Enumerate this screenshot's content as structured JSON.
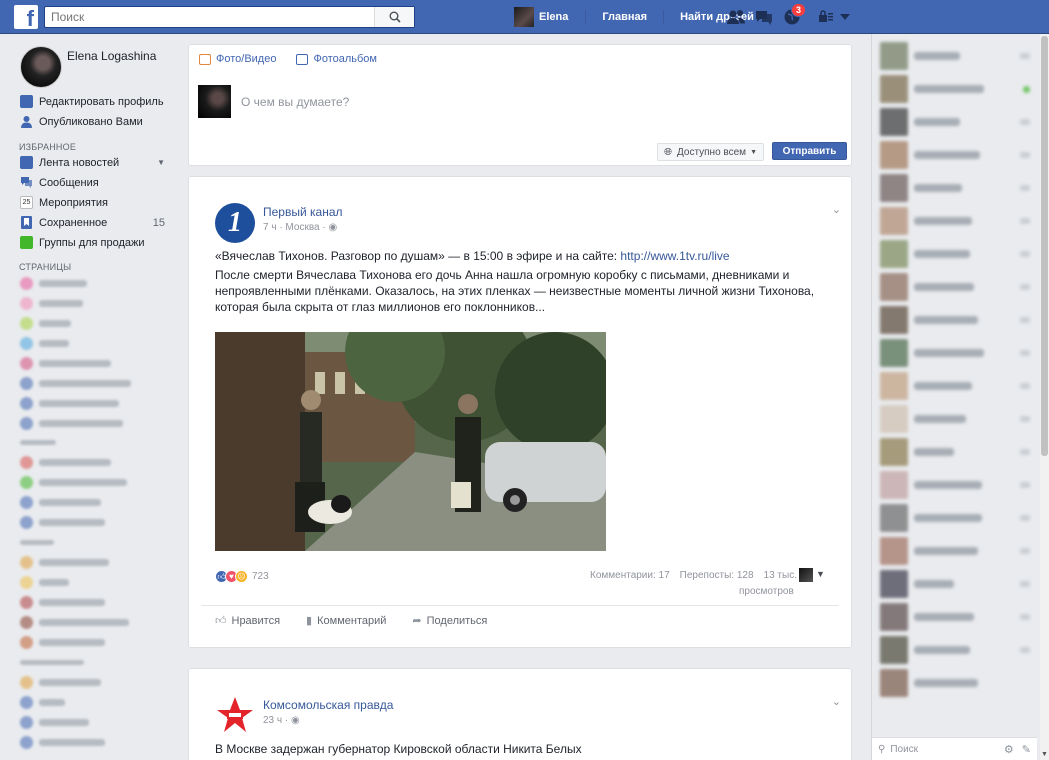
{
  "topbar": {
    "logo": "f",
    "search_placeholder": "Поиск",
    "user_name": "Elena",
    "nav": [
      "Главная",
      "Найти друзей"
    ],
    "notif_count": "3",
    "brand_color": "#4267b2"
  },
  "left": {
    "profile_name": "Elena Logashina",
    "edit_profile": "Редактировать профиль",
    "published": "Опубликовано Вами",
    "favorites_head": "ИЗБРАННОЕ",
    "favorites": [
      {
        "label": "Лента новостей",
        "icon": "newsfeed-icon",
        "count": ""
      },
      {
        "label": "Сообщения",
        "icon": "messages-icon",
        "count": ""
      },
      {
        "label": "Мероприятия",
        "icon": "calendar-icon",
        "count": ""
      },
      {
        "label": "Сохраненное",
        "icon": "bookmark-icon",
        "count": "15"
      },
      {
        "label": "Группы для продажи",
        "icon": "sale-groups-icon",
        "count": ""
      }
    ],
    "calendar_day": "25",
    "pages_head": "СТРАНИЦЫ"
  },
  "composer": {
    "tab_photo": "Фото/Видео",
    "tab_album": "Фотоальбом",
    "placeholder": "О чем вы думаете?",
    "privacy": "Доступно всем",
    "send": "Отправить"
  },
  "post1": {
    "page_name": "Первый канал",
    "meta": "7 ч · Москва ·",
    "title": "«Вячеслав Тихонов. Разговор по душам» — в 15:00 в эфире и на сайте: ",
    "link": "http://www.1tv.ru/live",
    "body": "После смерти Вячеслава Тихонова его дочь Анна нашла огромную коробку с письмами, дневниками и непроявленными плёнками. Оказалось, на этих пленках — неизвестные моменты личной жизни Тихонова, которая была скрыта от глаз миллионов его поклонников...",
    "reactions_count": "723",
    "comments": "Комментарии: 17",
    "shares": "Перепосты: 128",
    "views_a": "13 тыс.",
    "views_b": "просмотров",
    "like": "Нравится",
    "comment": "Комментарий",
    "share": "Поделиться"
  },
  "post2": {
    "page_name": "Комсомольская правда",
    "meta": "23 ч ·",
    "title": "В Москве задержан губернатор Кировской области Никита Белых"
  },
  "chat": {
    "search_placeholder": "Поиск"
  }
}
